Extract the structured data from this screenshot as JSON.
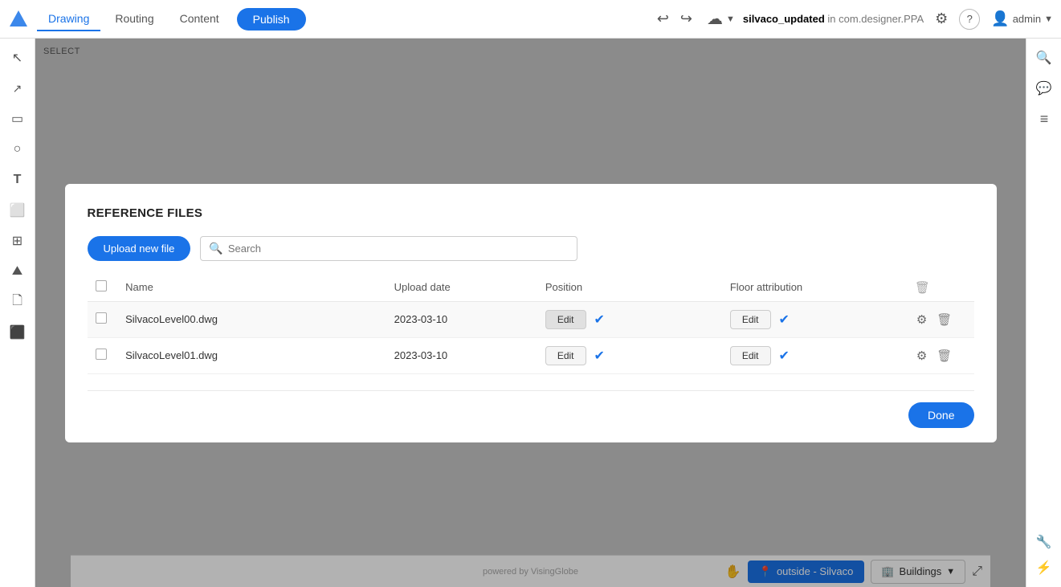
{
  "topbar": {
    "tabs": [
      {
        "label": "Drawing",
        "active": true
      },
      {
        "label": "Routing",
        "active": false
      },
      {
        "label": "Content",
        "active": false
      }
    ],
    "publish_label": "Publish",
    "project_name": "silvaco_updated",
    "project_context": "in com.designer.PPA",
    "undo_icon": "↩",
    "redo_icon": "↪",
    "cloud_icon": "☁",
    "settings_icon": "⚙",
    "help_icon": "?",
    "user_label": "admin"
  },
  "sidebar_left": {
    "icons": [
      {
        "name": "cursor-icon",
        "symbol": "↖"
      },
      {
        "name": "line-icon",
        "symbol": "╱"
      },
      {
        "name": "rect-icon",
        "symbol": "▭"
      },
      {
        "name": "circle-icon",
        "symbol": "○"
      },
      {
        "name": "text-icon",
        "symbol": "T"
      },
      {
        "name": "box-icon",
        "symbol": "⬜"
      },
      {
        "name": "layers-icon",
        "symbol": "⊞"
      },
      {
        "name": "mountain-icon",
        "symbol": "⛰"
      },
      {
        "name": "page-icon",
        "symbol": "📄"
      },
      {
        "name": "stack-icon",
        "symbol": "≡"
      }
    ]
  },
  "sidebar_right": {
    "icons": [
      {
        "name": "search-icon",
        "symbol": "🔍"
      },
      {
        "name": "comment-icon",
        "symbol": "💬"
      },
      {
        "name": "menu-lines-icon",
        "symbol": "≡"
      },
      {
        "name": "tools-icon",
        "symbol": "🔧"
      },
      {
        "name": "lightning-icon",
        "symbol": "⚡",
        "color": "#e53935"
      }
    ]
  },
  "select_label": "SELECT",
  "bottom_bar": {
    "powered_by": "powered by VisingGlobe",
    "location_label": "outside - Silvaco",
    "buildings_label": "Buildings",
    "hand_icon": "✋",
    "expand_icon": "⤢"
  },
  "modal": {
    "title": "REFERENCE FILES",
    "upload_btn_label": "Upload new file",
    "search_placeholder": "Search",
    "search_icon": "🔍",
    "table_headers": {
      "checkbox": "",
      "name": "Name",
      "upload_date": "Upload date",
      "position": "Position",
      "floor_attribution": "Floor attribution",
      "actions": ""
    },
    "rows": [
      {
        "id": 1,
        "checked": false,
        "name": "SilvacoLevel00.dwg",
        "upload_date": "2023-03-10",
        "position_edit": "Edit",
        "position_confirmed": true,
        "floor_edit": "Edit",
        "floor_confirmed": true
      },
      {
        "id": 2,
        "checked": false,
        "name": "SilvacoLevel01.dwg",
        "upload_date": "2023-03-10",
        "position_edit": "Edit",
        "position_confirmed": true,
        "floor_edit": "Edit",
        "floor_confirmed": true
      }
    ],
    "done_label": "Done",
    "gear_icon": "⚙",
    "delete_icon": "🗑",
    "check_icon": "✔"
  }
}
